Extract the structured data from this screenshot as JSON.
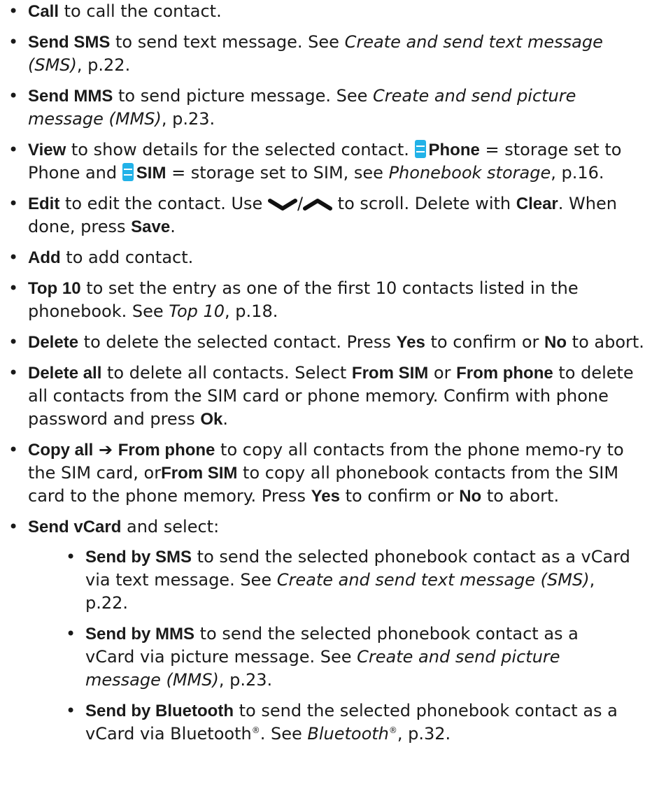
{
  "bullet_glyph": "•",
  "accent_color": "#22b2e8",
  "items": {
    "call": {
      "term": "Call",
      "text": " to call the contact."
    },
    "send_sms": {
      "term": "Send SMS",
      "text": " to send text message. See ",
      "ref": "Create and send text message (SMS)",
      "after": ", p.22."
    },
    "send_mms": {
      "term": "Send MMS",
      "text": " to send picture message. See ",
      "ref": "Create and send picture message (MMS)",
      "after": ", p.23."
    },
    "view": {
      "term": "View",
      "text": " to show details for the selected contact. ",
      "phone_label": "Phone",
      "phone_text": " = storage set to Phone and ",
      "sim_label": "SIM",
      "sim_text": " = storage set to SIM, see ",
      "ref": "Phonebook storage",
      "after": ", p.16."
    },
    "edit": {
      "term": "Edit",
      "text": " to edit the contact. Use ",
      "slash": "/",
      "text2": " to scroll. Delete with ",
      "clear": "Clear",
      "text3": ". When done, press ",
      "save": "Save",
      "end": "."
    },
    "add": {
      "term": "Add",
      "text": " to add contact."
    },
    "top10": {
      "term": "Top 10",
      "text": " to set the entry as one of the first 10 contacts listed in the phonebook. See ",
      "ref": "Top 10",
      "after": ", p.18."
    },
    "delete": {
      "term": "Delete",
      "text": " to delete the selected contact. Press ",
      "yes": "Yes",
      "text2": " to confirm or ",
      "no": "No",
      "text3": " to abort."
    },
    "delete_all": {
      "term": "Delete all",
      "text": " to delete all contacts. Select ",
      "from_sim": "From SIM",
      "or": " or ",
      "from_phone": "From phone",
      "text2": " to delete all contacts from the SIM card or phone memory. Confirm with phone password and press ",
      "ok": "Ok",
      "end": "."
    },
    "copy_all": {
      "term": "Copy all",
      "arrow": "➔",
      "from_phone": "From phone",
      "text": " to copy all contacts from the phone memo-ry to the SIM card, or",
      "from_sim": "From SIM",
      "text2": " to copy all phonebook contacts from the SIM card to the phone memory. Press ",
      "yes": "Yes",
      "text3": " to confirm or ",
      "no": "No",
      "text4": " to abort."
    },
    "send_vcard": {
      "term": "Send vCard",
      "text": " and select:"
    }
  },
  "sub_items": {
    "by_sms": {
      "term": "Send by SMS",
      "text": " to send the selected phonebook contact as a vCard via text message. See ",
      "ref": "Create and send text message (SMS)",
      "after": ", p.22."
    },
    "by_mms": {
      "term": "Send by MMS",
      "text": " to send the selected phonebook contact as a vCard via picture message. See ",
      "ref": "Create and send picture message (MMS)",
      "after": ", p.23."
    },
    "by_bt": {
      "term": "Send by Bluetooth",
      "text": " to send the selected phonebook contact as a vCard via Bluetooth",
      "reg": "®",
      "text2": ". See ",
      "ref": "Bluetooth",
      "ref_reg": "®",
      "after": ", p.32."
    }
  }
}
